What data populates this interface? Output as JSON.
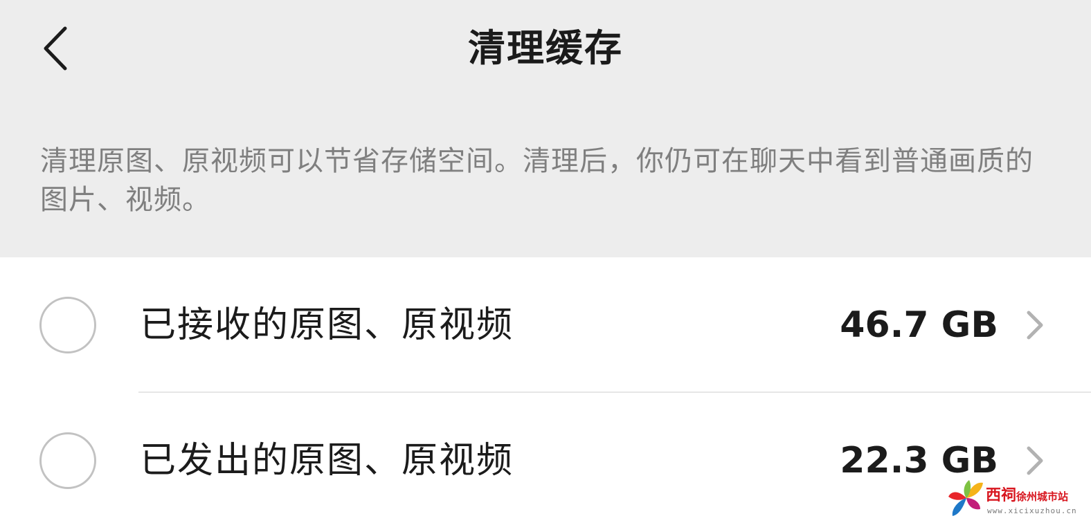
{
  "header": {
    "title": "清理缓存",
    "back_icon": "chevron-left-icon"
  },
  "description": "清理原图、原视频可以节省存储空间。清理后，你仍可在聊天中看到普通画质的图片、视频。",
  "items": [
    {
      "label": "已接收的原图、原视频",
      "size": "46.7 GB",
      "checked": false,
      "chevron_icon": "chevron-right-icon"
    },
    {
      "label": "已发出的原图、原视频",
      "size": "22.3 GB",
      "checked": false,
      "chevron_icon": "chevron-right-icon"
    }
  ],
  "watermark": {
    "brand_main": "西祠",
    "brand_sub": "徐州城市站",
    "url": "www.xicixuzhou.cn"
  },
  "colors": {
    "background": "#ededed",
    "surface": "#ffffff",
    "text_primary": "#1b1b1b",
    "text_secondary": "#7f7f7f",
    "checkbox_border": "#c2c2c2",
    "chevron": "#b2b2b2",
    "divider": "#e6e6e6",
    "watermark_red": "#d8161f"
  }
}
